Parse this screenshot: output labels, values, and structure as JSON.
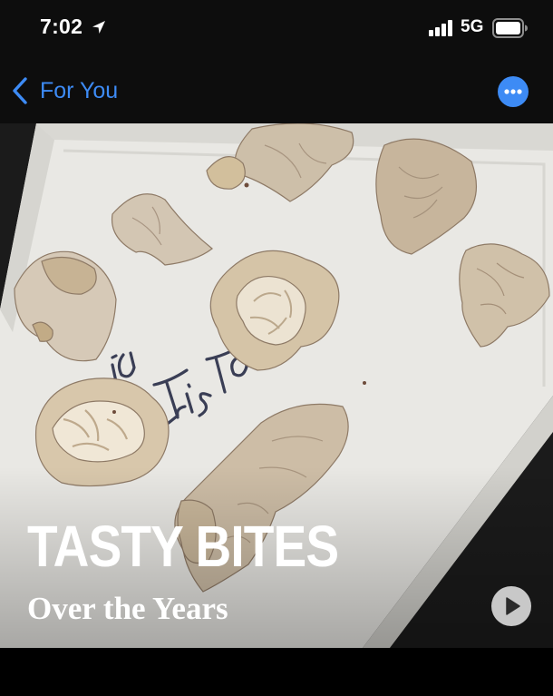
{
  "status_bar": {
    "time": "7:02",
    "network": "5G",
    "icons": [
      "location-arrow-icon",
      "signal-bars-icon",
      "battery-icon"
    ]
  },
  "nav": {
    "back_label": "For You",
    "back_icon": "chevron-left-icon",
    "more_icon": "ellipsis-circle-icon"
  },
  "memory": {
    "title": "TASTY BITES",
    "subtitle": "Over the Years",
    "play_icon": "play-icon",
    "photo_handwriting": [
      "Faria",
      "&",
      "Trista"
    ]
  },
  "colors": {
    "accent": "#3d8bf5",
    "background": "#000000",
    "bar_background": "#0d0d0d",
    "tray": "#ebeae6"
  }
}
